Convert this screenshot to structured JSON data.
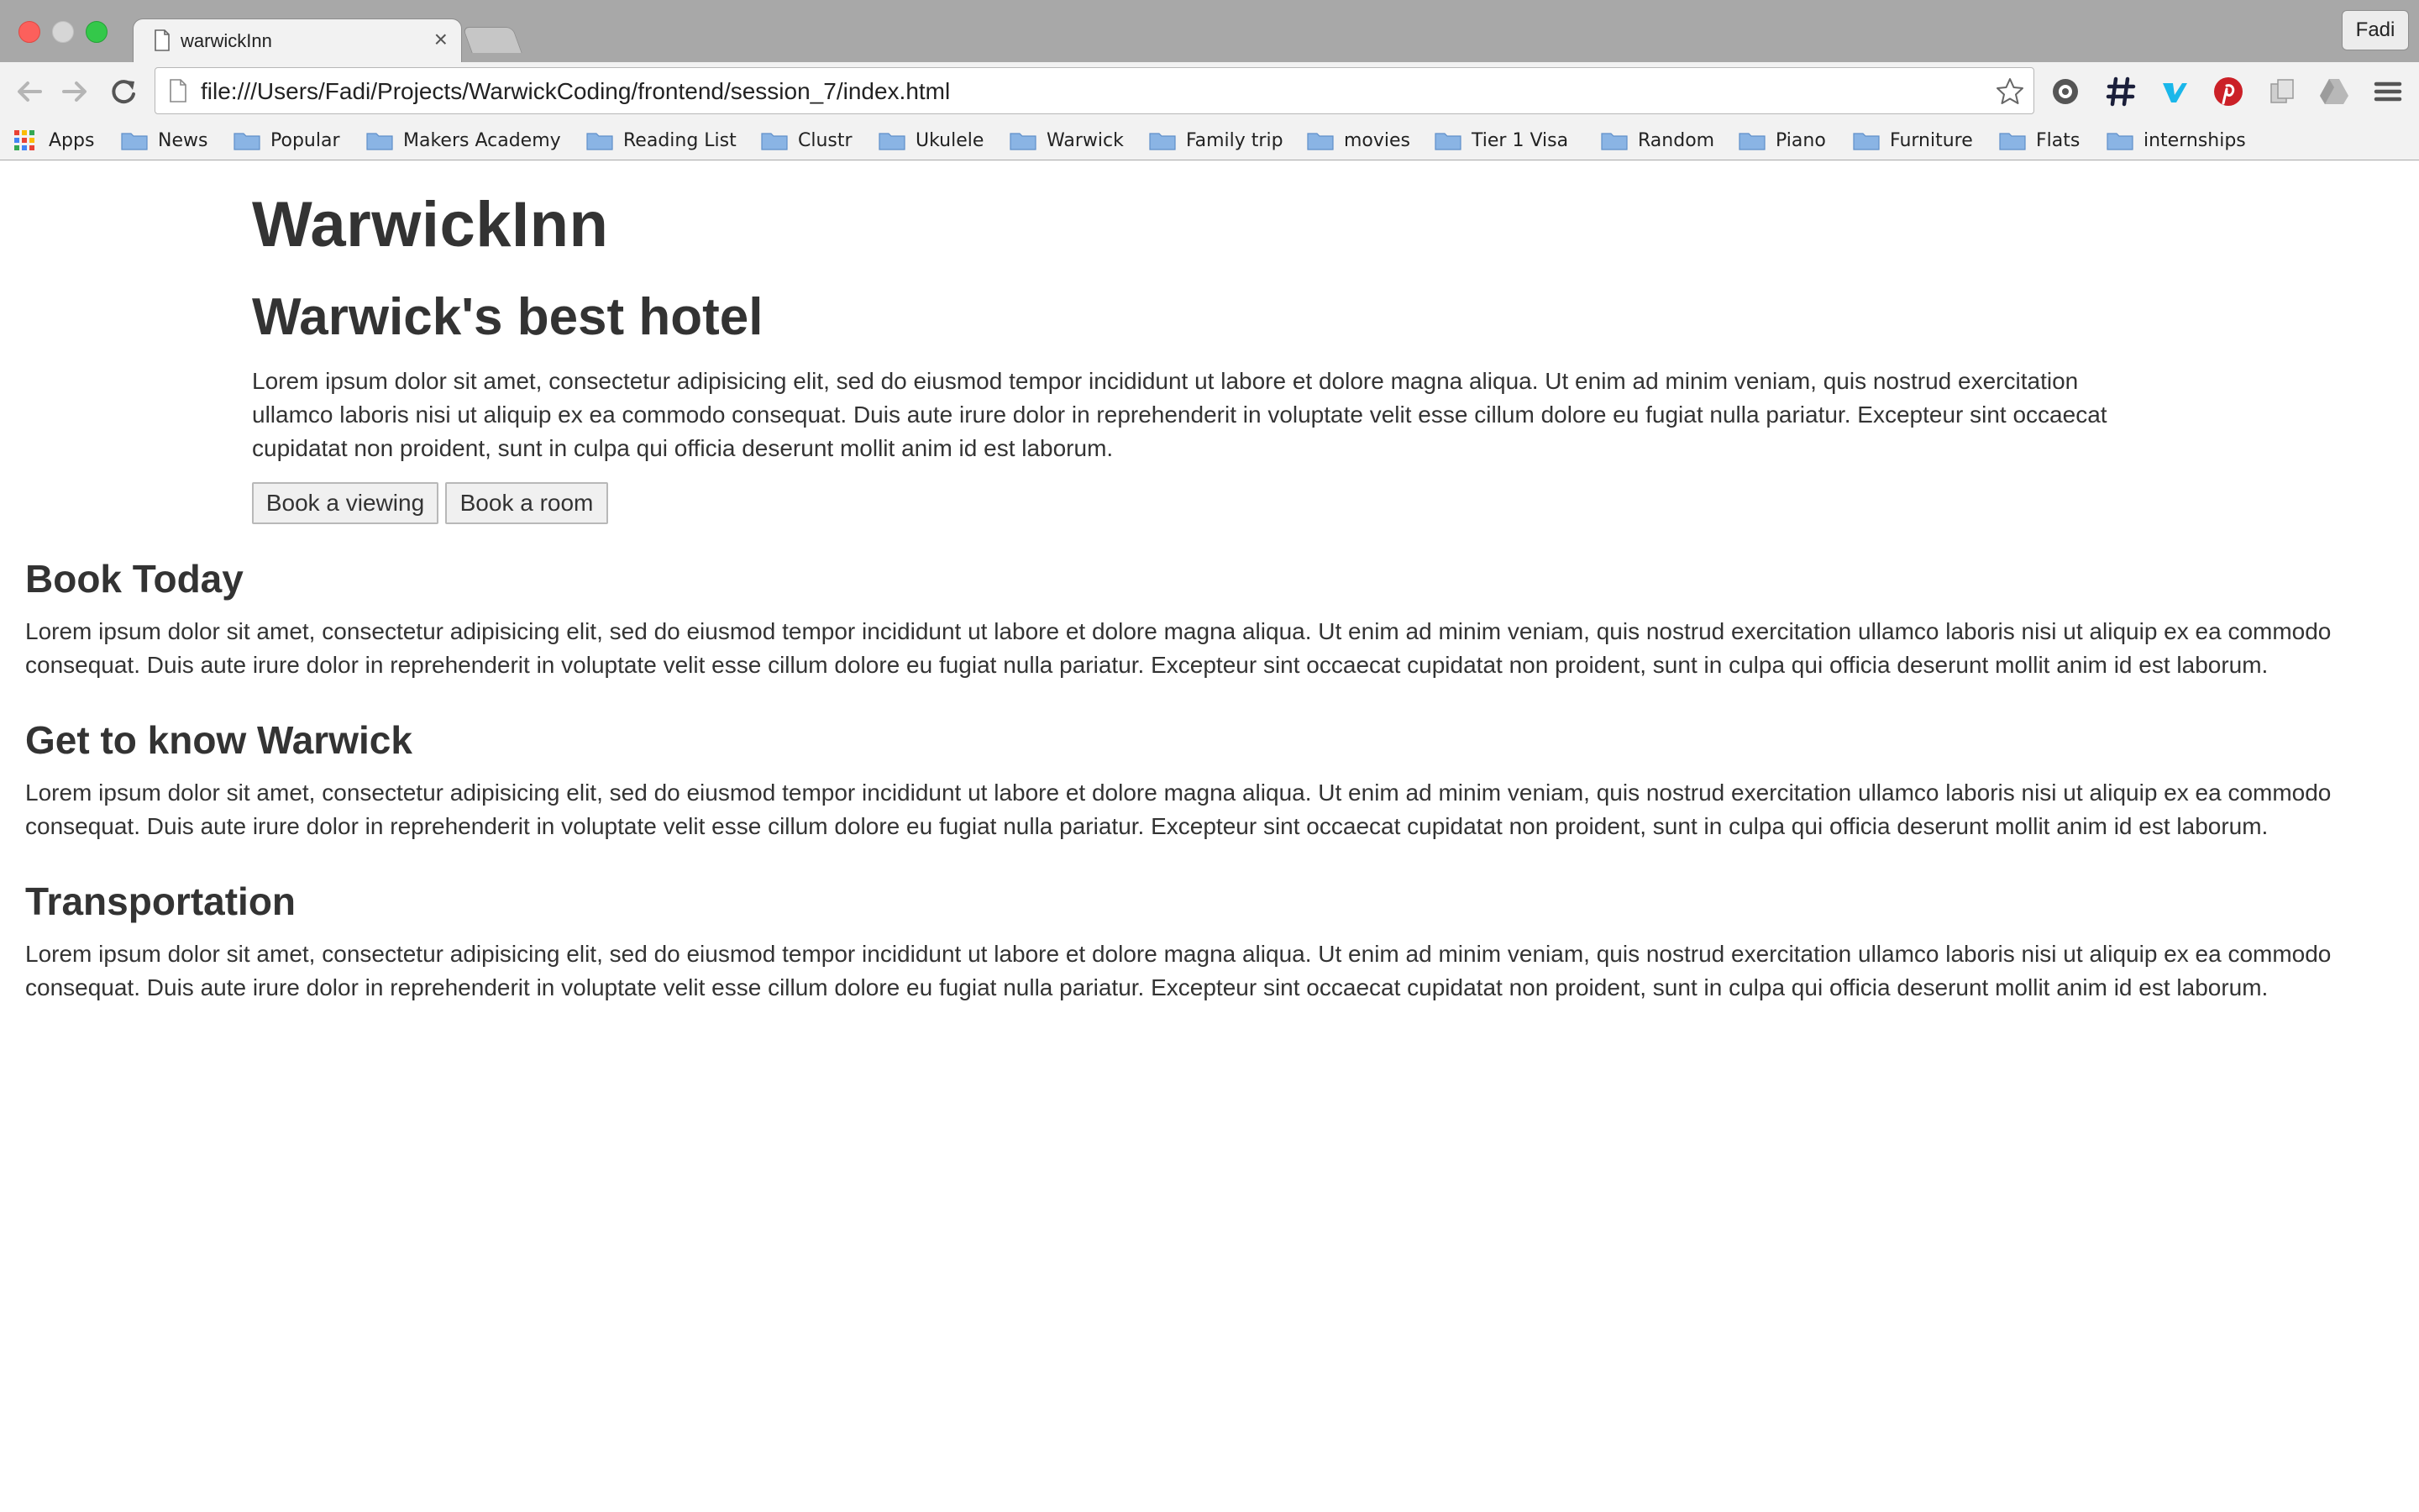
{
  "browser": {
    "tab_title": "warwickInn",
    "tab_close": "×",
    "profile_name": "Fadi",
    "url": "file:///Users/Fadi/Projects/WarwickCoding/frontend/session_7/index.html",
    "icons": [
      "back-arrow-icon",
      "forward-arrow-icon",
      "reload-icon",
      "page-icon",
      "star-icon",
      "ghostery-icon",
      "hashtag-icon",
      "vimeo-icon",
      "pinterest-icon",
      "pages-icon",
      "google-drive-icon",
      "hamburger-menu-icon"
    ]
  },
  "bookmarks": [
    "Apps",
    "News",
    "Popular",
    "Makers Academy",
    "Reading List",
    "Clustr",
    "Ukulele",
    "Warwick",
    "Family trip",
    "movies",
    "Tier 1 Visa",
    "Random",
    "Piano",
    "Furniture",
    "Flats",
    "internships"
  ],
  "hero": {
    "title": "WarwickInn",
    "subtitle": "Warwick's best hotel",
    "text": "Lorem ipsum dolor sit amet, consectetur adipisicing elit, sed do eiusmod tempor incididunt ut labore et dolore magna aliqua. Ut enim ad minim veniam, quis nostrud exercitation ullamco laboris nisi ut aliquip ex ea commodo consequat. Duis aute irure dolor in reprehenderit in voluptate velit esse cillum dolore eu fugiat nulla pariatur. Excepteur sint occaecat cupidatat non proident, sunt in culpa qui officia deserunt mollit anim id est laborum.",
    "buttons": {
      "viewing": "Book a viewing",
      "room": "Book a room"
    }
  },
  "sections": [
    {
      "heading": "Book Today",
      "text": "Lorem ipsum dolor sit amet, consectetur adipisicing elit, sed do eiusmod tempor incididunt ut labore et dolore magna aliqua. Ut enim ad minim veniam, quis nostrud exercitation ullamco laboris nisi ut aliquip ex ea commodo consequat. Duis aute irure dolor in reprehenderit in voluptate velit esse cillum dolore eu fugiat nulla pariatur. Excepteur sint occaecat cupidatat non proident, sunt in culpa qui officia deserunt mollit anim id est laborum."
    },
    {
      "heading": "Get to know Warwick",
      "text": "Lorem ipsum dolor sit amet, consectetur adipisicing elit, sed do eiusmod tempor incididunt ut labore et dolore magna aliqua. Ut enim ad minim veniam, quis nostrud exercitation ullamco laboris nisi ut aliquip ex ea commodo consequat. Duis aute irure dolor in reprehenderit in voluptate velit esse cillum dolore eu fugiat nulla pariatur. Excepteur sint occaecat cupidatat non proident, sunt in culpa qui officia deserunt mollit anim id est laborum."
    },
    {
      "heading": "Transportation",
      "text": "Lorem ipsum dolor sit amet, consectetur adipisicing elit, sed do eiusmod tempor incididunt ut labore et dolore magna aliqua. Ut enim ad minim veniam, quis nostrud exercitation ullamco laboris nisi ut aliquip ex ea commodo consequat. Duis aute irure dolor in reprehenderit in voluptate velit esse cillum dolore eu fugiat nulla pariatur. Excepteur sint occaecat cupidatat non proident, sunt in culpa qui officia deserunt mollit anim id est laborum."
    }
  ],
  "colors": {
    "titlebar": "#a8a8a8",
    "toolbar": "#f2f2f2",
    "text": "#333333",
    "folder": "#8ab4e4",
    "pinterest": "#cb2027",
    "vimeo": "#1ab7ea"
  }
}
